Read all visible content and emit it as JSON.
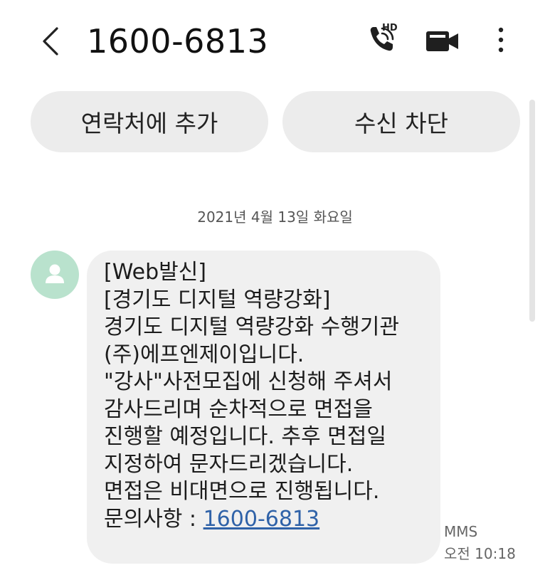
{
  "header": {
    "title": "1600-6813",
    "back_icon": "chevron-left-icon",
    "call_icon": "phone-hd-icon",
    "call_badge": "HD",
    "video_icon": "video-camera-icon",
    "more_icon": "more-vertical-icon"
  },
  "actions": {
    "add_contact_label": "연락처에 추가",
    "block_label": "수신 차단"
  },
  "conversation": {
    "date_label": "2021년 4월 13일 화요일",
    "message": {
      "lines": [
        "[Web발신]",
        "[경기도 디지털 역량강화]",
        "경기도 디지털 역량강화 수행기관",
        "(주)에프엔제이입니다.",
        "\"강사\"사전모집에 신청해 주셔서",
        "감사드리며 순차적으로 면접을",
        "진행할 예정입니다. 추후 면접일",
        "지정하여 문자드리겠습니다.",
        "면접은 비대면으로 진행됩니다."
      ],
      "inquiry_label": "문의사항 : ",
      "phone_link": "1600-6813",
      "type": "MMS",
      "time": "오전 10:18"
    }
  },
  "colors": {
    "avatar_bg": "#b9e2cd",
    "bubble_bg": "#f0f0f0",
    "button_bg": "#ececec",
    "link": "#2f62a8"
  }
}
